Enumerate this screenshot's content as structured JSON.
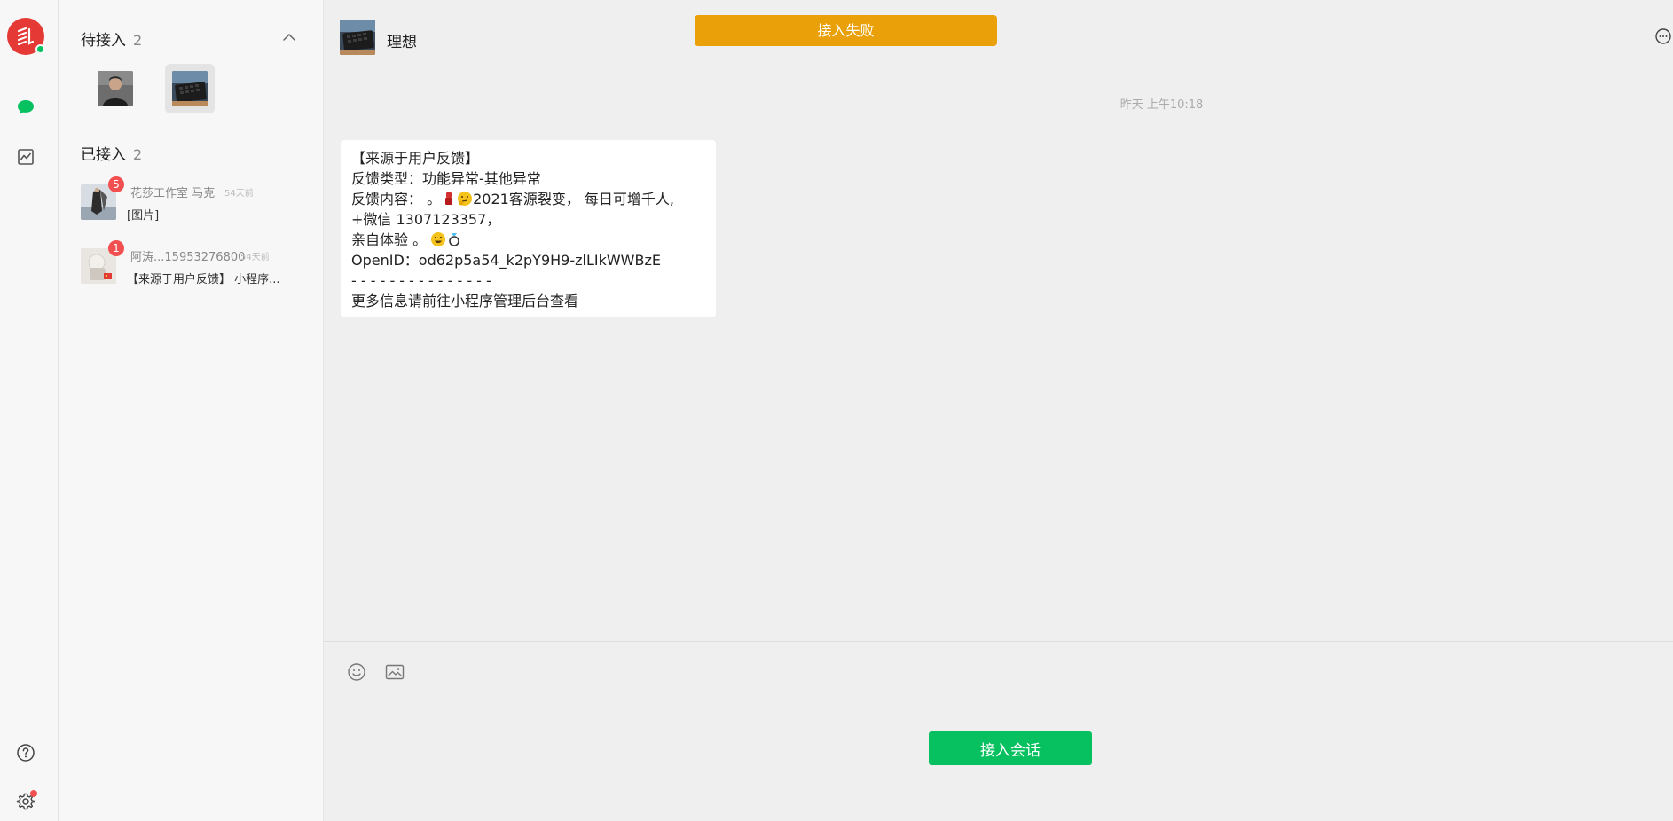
{
  "toast": {
    "text": "接入失败"
  },
  "pending": {
    "title": "待接入",
    "count": "2"
  },
  "joined": {
    "title": "已接入",
    "count": "2",
    "items": [
      {
        "name": "花莎工作室 马克",
        "time": "54天前",
        "preview": "[图片]",
        "badge": "5"
      },
      {
        "name": "阿涛...15953276800",
        "time": "54天前",
        "preview": "【来源于用户反馈】 小程序...",
        "badge": "1"
      }
    ]
  },
  "chat": {
    "title": "理想",
    "timestamp": "昨天 上午10:18",
    "message": {
      "line1": "【来源于用户反馈】",
      "line2": "反馈类型：功能异常-其他异常",
      "line3_a": "反馈内容： 。",
      "line3_b": "2021客源裂变， 每日可增千人,",
      "line4": "+微信 1307123357，",
      "line5": "亲自体验 。",
      "line6": "OpenID：od62p5a54_k2pY9H9-zlLIkWWBzE",
      "line7": "- - - - - - - - - - - - - - -",
      "line8": "更多信息请前往小程序管理后台查看"
    }
  },
  "composer": {
    "accept_label": "接入会话"
  },
  "icons": {
    "logo": "app-logo",
    "chat": "chat-bubble-icon",
    "stats": "chart-icon",
    "help": "help-icon",
    "settings": "gear-icon",
    "emoji": "smiley-icon",
    "image": "image-icon",
    "more": "more-icon",
    "collapse": "chevron-up-icon"
  },
  "colors": {
    "accent": "#07c160",
    "warning": "#eaa008",
    "badge": "#f25050",
    "brand": "#e53935"
  }
}
